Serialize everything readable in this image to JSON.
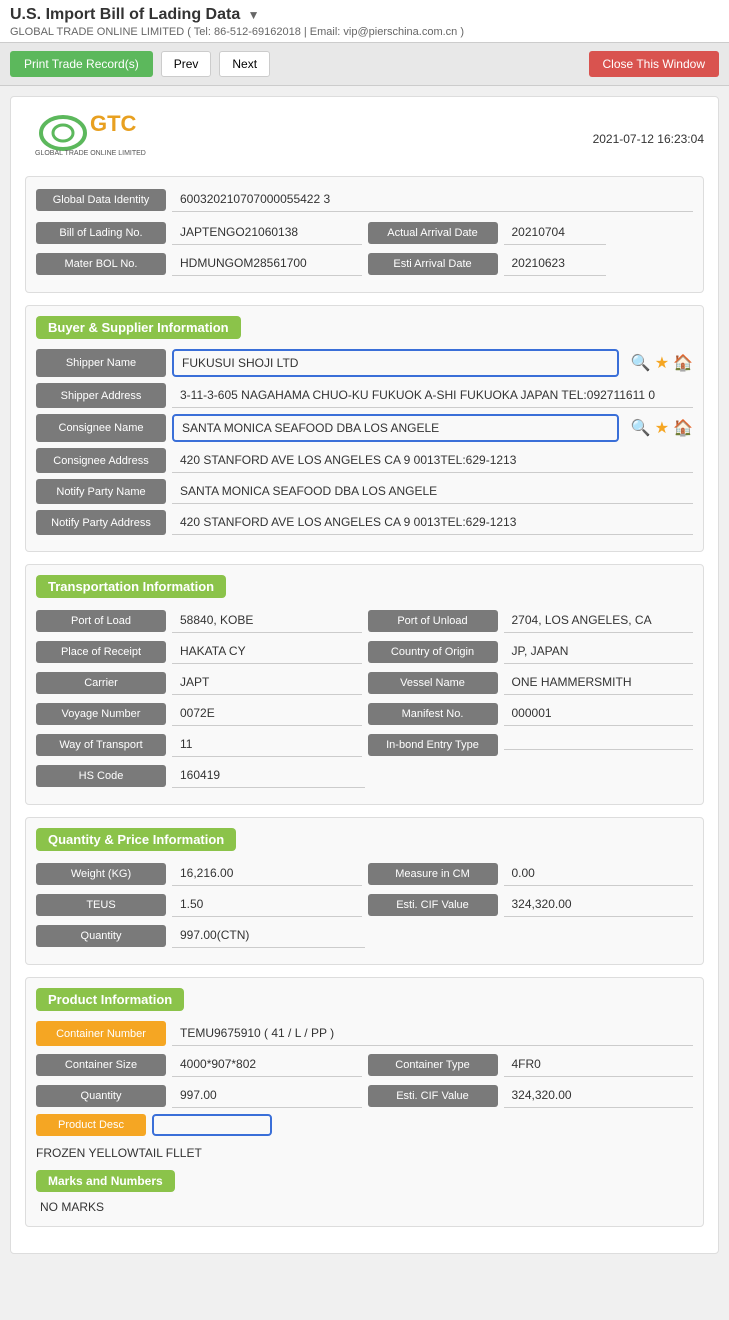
{
  "header": {
    "title": "U.S. Import Bill of Lading Data",
    "subtitle": "GLOBAL TRADE ONLINE LIMITED ( Tel: 86-512-69162018 | Email: vip@pierschina.com.cn )",
    "datetime": "2021-07-12 16:23:04"
  },
  "toolbar": {
    "print_label": "Print Trade Record(s)",
    "prev_label": "Prev",
    "next_label": "Next",
    "close_label": "Close This Window"
  },
  "record": {
    "global_data_identity": {
      "label": "Global Data Identity",
      "value": "600320210707000055422 3"
    },
    "bill_of_lading": {
      "label": "Bill of Lading No.",
      "value": "JAPTENGO21060138"
    },
    "actual_arrival_date": {
      "label": "Actual Arrival Date",
      "value": "20210704"
    },
    "master_bol": {
      "label": "Mater BOL No.",
      "value": "HDMUNGOM28561700"
    },
    "esti_arrival_date": {
      "label": "Esti Arrival Date",
      "value": "20210623"
    }
  },
  "buyer_supplier": {
    "section_title": "Buyer & Supplier Information",
    "shipper_name": {
      "label": "Shipper Name",
      "value": "FUKUSUI SHOJI LTD"
    },
    "shipper_address": {
      "label": "Shipper Address",
      "value": "3-11-3-605 NAGAHAMA CHUO-KU FUKUOK A-SHI FUKUOKA JAPAN TEL:092711611 0"
    },
    "consignee_name": {
      "label": "Consignee Name",
      "value": "SANTA MONICA SEAFOOD DBA LOS ANGELE"
    },
    "consignee_address": {
      "label": "Consignee Address",
      "value": "420 STANFORD AVE LOS ANGELES CA 9 0013TEL:629-1213"
    },
    "notify_party_name": {
      "label": "Notify Party Name",
      "value": "SANTA MONICA SEAFOOD DBA LOS ANGELE"
    },
    "notify_party_address": {
      "label": "Notify Party Address",
      "value": "420 STANFORD AVE LOS ANGELES CA 9 0013TEL:629-1213"
    }
  },
  "transportation": {
    "section_title": "Transportation Information",
    "port_of_load": {
      "label": "Port of Load",
      "value": "58840, KOBE"
    },
    "port_of_unload": {
      "label": "Port of Unload",
      "value": "2704, LOS ANGELES, CA"
    },
    "place_of_receipt": {
      "label": "Place of Receipt",
      "value": "HAKATA CY"
    },
    "country_of_origin": {
      "label": "Country of Origin",
      "value": "JP, JAPAN"
    },
    "carrier": {
      "label": "Carrier",
      "value": "JAPT"
    },
    "vessel_name": {
      "label": "Vessel Name",
      "value": "ONE HAMMERSMITH"
    },
    "voyage_number": {
      "label": "Voyage Number",
      "value": "0072E"
    },
    "manifest_no": {
      "label": "Manifest No.",
      "value": "000001"
    },
    "way_of_transport": {
      "label": "Way of Transport",
      "value": "11"
    },
    "in_bond_entry_type": {
      "label": "In-bond Entry Type",
      "value": ""
    },
    "hs_code": {
      "label": "HS Code",
      "value": "160419"
    }
  },
  "quantity_price": {
    "section_title": "Quantity & Price Information",
    "weight_kg": {
      "label": "Weight (KG)",
      "value": "16,216.00"
    },
    "measure_in_cm": {
      "label": "Measure in CM",
      "value": "0.00"
    },
    "teus": {
      "label": "TEUS",
      "value": "1.50"
    },
    "esti_cif_value": {
      "label": "Esti. CIF Value",
      "value": "324,320.00"
    },
    "quantity": {
      "label": "Quantity",
      "value": "997.00(CTN)"
    }
  },
  "product": {
    "section_title": "Product Information",
    "container_number": {
      "label": "Container Number",
      "value": "TEMU9675910 ( 41 / L / PP )"
    },
    "container_size": {
      "label": "Container Size",
      "value": "4000*907*802"
    },
    "container_type": {
      "label": "Container Type",
      "value": "4FR0"
    },
    "quantity": {
      "label": "Quantity",
      "value": "997.00"
    },
    "esti_cif_value": {
      "label": "Esti. CIF Value",
      "value": "324,320.00"
    },
    "product_desc": {
      "label": "Product Desc",
      "value": "FROZEN YELLOWTAIL FLLET"
    },
    "marks_and_numbers": {
      "label": "Marks and Numbers",
      "value": "NO MARKS"
    }
  },
  "icons": {
    "search": "🔍",
    "star": "★",
    "home": "🏠",
    "dropdown": "▼"
  }
}
